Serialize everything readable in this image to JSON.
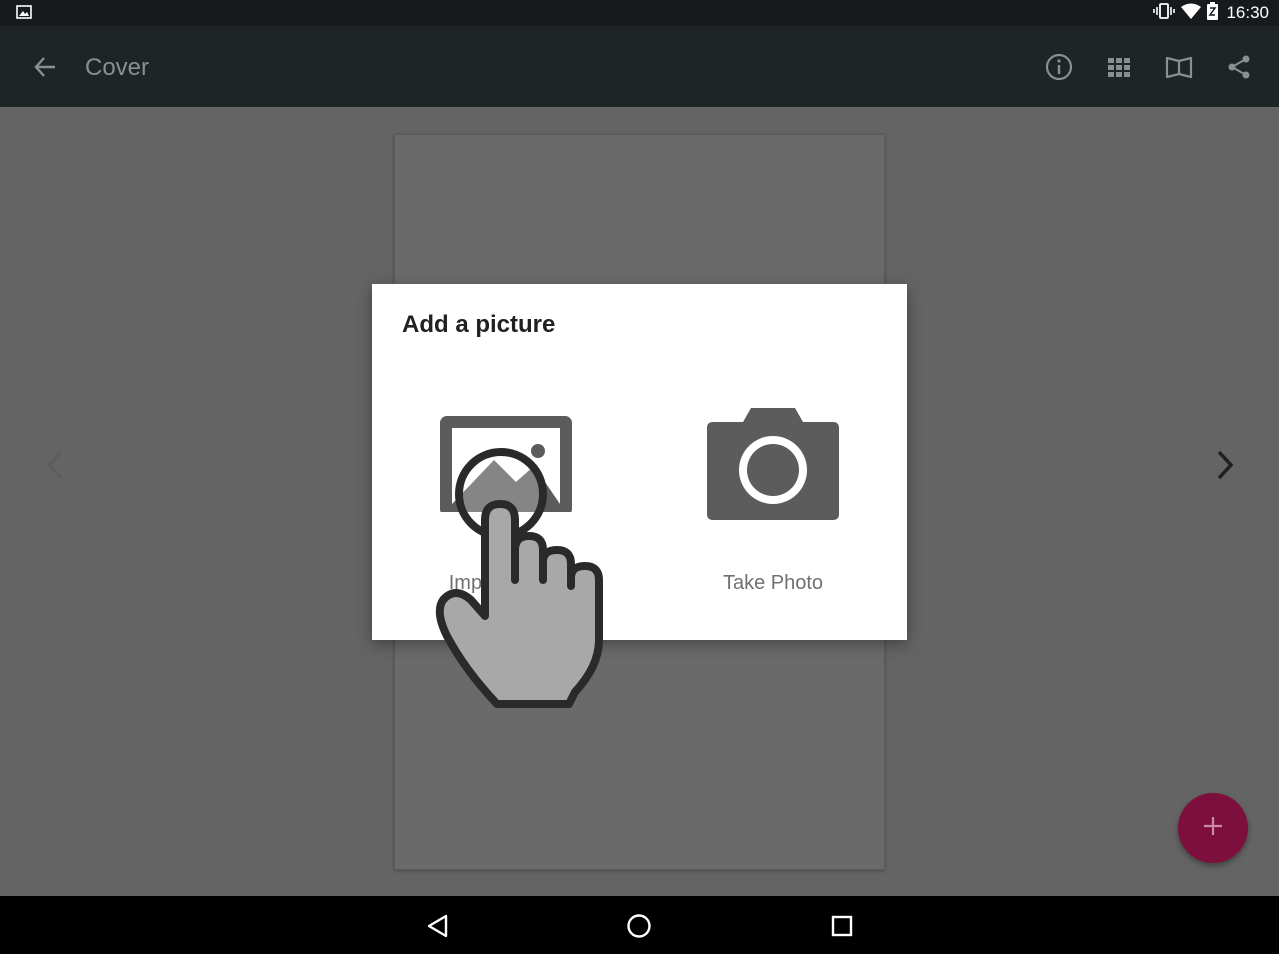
{
  "status_bar": {
    "time": "16:30",
    "icons": [
      "picture-icon",
      "vibrate-icon",
      "wifi-icon",
      "battery-icon"
    ]
  },
  "toolbar": {
    "title": "Cover",
    "actions": [
      "info-icon",
      "grid-icon",
      "book-icon",
      "share-icon"
    ]
  },
  "dialog": {
    "title": "Add a picture",
    "options": [
      {
        "label": "Import Photo",
        "icon": "image-icon"
      },
      {
        "label": "Take Photo",
        "icon": "camera-icon"
      }
    ]
  },
  "navigation": {
    "prev_icon": "chevron-left-icon",
    "next_icon": "chevron-right-icon",
    "fab_icon": "plus-icon"
  },
  "system_nav": [
    "back-triangle-icon",
    "home-circle-icon",
    "recents-square-icon"
  ],
  "colors": {
    "status_bar": "#161a1c",
    "toolbar": "#1f2427",
    "content_dim": "#646464",
    "fab": "#7c0f3c",
    "dialog_bg": "#ffffff",
    "icon_dark": "#5c5c5c"
  }
}
